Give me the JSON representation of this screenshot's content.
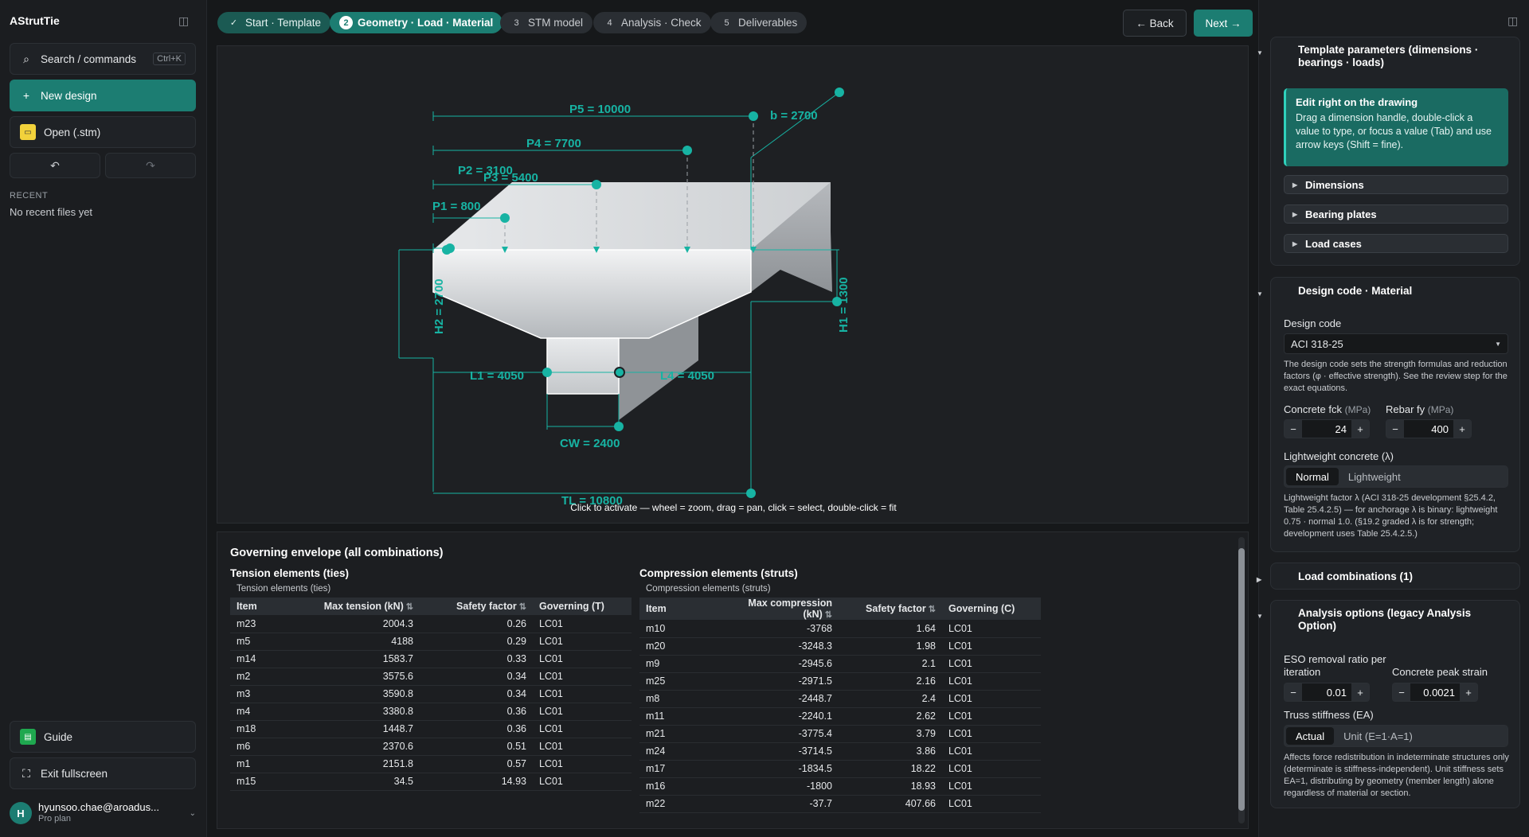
{
  "app": {
    "name": "AStrutTie"
  },
  "sidebar": {
    "search_label": "Search / commands",
    "search_shortcut": "Ctrl+K",
    "new_design": "New design",
    "open": "Open (.stm)",
    "recent_heading": "RECENT",
    "recent_empty": "No recent files yet",
    "guide": "Guide",
    "exit_fullscreen": "Exit fullscreen",
    "user": {
      "initial": "H",
      "email": "hyunsoo.chae@aroadus...",
      "plan": "Pro plan"
    }
  },
  "steps": [
    {
      "num": "✓",
      "label": "Start · Template",
      "state": "done"
    },
    {
      "num": "2",
      "label": "Geometry · Load · Material",
      "state": "active"
    },
    {
      "num": "3",
      "label": "STM model",
      "state": "todo"
    },
    {
      "num": "4",
      "label": "Analysis · Check",
      "state": "todo"
    },
    {
      "num": "5",
      "label": "Deliverables",
      "state": "todo"
    }
  ],
  "nav": {
    "back": "← Back",
    "next": "Next →"
  },
  "drawing": {
    "loads": [
      "P5 = 10000",
      "P4 = 7700",
      "P3 = 5400",
      "P2 = 3100",
      "P1 = 800"
    ],
    "b": "b = 2700",
    "h1": "H1 = 1300",
    "h2": "H2 = 2700",
    "l1": "L1 = 4050",
    "l4": "L4 = 4050",
    "cw": "CW = 2400",
    "tl": "TL = 10800",
    "hint": "Click to activate — wheel = zoom, drag = pan, click = select, double-click = fit"
  },
  "results": {
    "title": "Governing envelope (all combinations)",
    "tension": {
      "heading": "Tension elements (ties)",
      "caption": "Tension elements (ties)",
      "columns": [
        "Item",
        "Max tension (kN)",
        "Safety factor",
        "Governing (T)"
      ],
      "rows": [
        [
          "m23",
          "2004.3",
          "0.26",
          "LC01"
        ],
        [
          "m5",
          "4188",
          "0.29",
          "LC01"
        ],
        [
          "m14",
          "1583.7",
          "0.33",
          "LC01"
        ],
        [
          "m2",
          "3575.6",
          "0.34",
          "LC01"
        ],
        [
          "m3",
          "3590.8",
          "0.34",
          "LC01"
        ],
        [
          "m4",
          "3380.8",
          "0.36",
          "LC01"
        ],
        [
          "m18",
          "1448.7",
          "0.36",
          "LC01"
        ],
        [
          "m6",
          "2370.6",
          "0.51",
          "LC01"
        ],
        [
          "m1",
          "2151.8",
          "0.57",
          "LC01"
        ],
        [
          "m15",
          "34.5",
          "14.93",
          "LC01"
        ]
      ]
    },
    "compression": {
      "heading": "Compression elements (struts)",
      "caption": "Compression elements (struts)",
      "columns": [
        "Item",
        "Max compression (kN)",
        "Safety factor",
        "Governing (C)"
      ],
      "rows": [
        [
          "m10",
          "-3768",
          "1.64",
          "LC01"
        ],
        [
          "m20",
          "-3248.3",
          "1.98",
          "LC01"
        ],
        [
          "m9",
          "-2945.6",
          "2.1",
          "LC01"
        ],
        [
          "m25",
          "-2971.5",
          "2.16",
          "LC01"
        ],
        [
          "m8",
          "-2448.7",
          "2.4",
          "LC01"
        ],
        [
          "m11",
          "-2240.1",
          "2.62",
          "LC01"
        ],
        [
          "m21",
          "-3775.4",
          "3.79",
          "LC01"
        ],
        [
          "m24",
          "-3714.5",
          "3.86",
          "LC01"
        ],
        [
          "m17",
          "-1834.5",
          "18.22",
          "LC01"
        ],
        [
          "m16",
          "-1800",
          "18.93",
          "LC01"
        ],
        [
          "m22",
          "-37.7",
          "407.66",
          "LC01"
        ]
      ]
    }
  },
  "right_panel": {
    "template_params": {
      "title": "Template parameters (dimensions · bearings · loads)",
      "hint_title": "Edit right on the drawing",
      "hint_body": "Drag a dimension handle, double-click a value to type, or focus a value (Tab) and use arrow keys (Shift = fine).",
      "sections": [
        "Dimensions",
        "Bearing plates",
        "Load cases"
      ]
    },
    "design": {
      "title": "Design code · Material",
      "code_label": "Design code",
      "code_value": "ACI 318-25",
      "code_note": "The design code sets the strength formulas and reduction factors (φ · effective strength). See the review step for the exact equations.",
      "fck_label": "Concrete fck",
      "fck_unit": "(MPa)",
      "fck_value": "24",
      "fy_label": "Rebar fy",
      "fy_unit": "(MPa)",
      "fy_value": "400",
      "lw_label": "Lightweight concrete (λ)",
      "lw_options": [
        "Normal",
        "Lightweight"
      ],
      "lw_note": "Lightweight factor λ (ACI 318-25 development §25.4.2, Table 25.4.2.5) — for anchorage λ is binary: lightweight 0.75 · normal 1.0. (§19.2 graded λ is for strength; development uses Table 25.4.2.5.)"
    },
    "load_combos": {
      "title": "Load combinations (1)"
    },
    "analysis": {
      "title": "Analysis options (legacy Analysis Option)",
      "eso_label": "ESO removal ratio per iteration",
      "eso_value": "0.01",
      "strain_label": "Concrete peak strain",
      "strain_value": "0.0021",
      "ea_label": "Truss stiffness (EA)",
      "ea_options": [
        "Actual",
        "Unit (E=1·A=1)"
      ],
      "ea_note": "Affects force redistribution in indeterminate structures only (determinate is stiffness-independent). Unit stiffness sets EA=1, distributing by geometry (member length) alone regardless of material or section."
    }
  },
  "colors": {
    "accent": "#1c7d72",
    "dim_line": "#17b3a3",
    "concrete_top": "#d8dbde"
  }
}
